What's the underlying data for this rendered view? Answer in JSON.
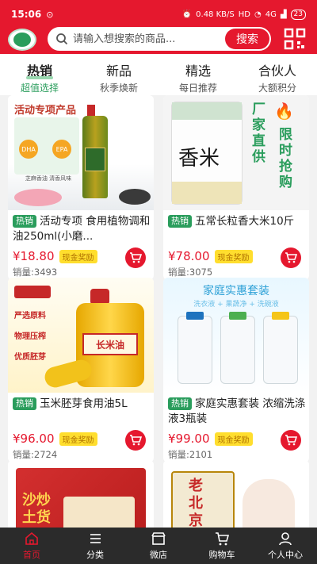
{
  "status_bar": {
    "time": "15:06",
    "net_speed": "0.48",
    "net_unit": "KB/S",
    "network": "HD",
    "signal": "4G",
    "battery": "23"
  },
  "search": {
    "placeholder": "请输入想搜索的商品...",
    "button_label": "搜索"
  },
  "tabs": [
    {
      "label": "热销",
      "sub": "超值选择"
    },
    {
      "label": "新品",
      "sub": "秋季焕新"
    },
    {
      "label": "精选",
      "sub": "每日推荐"
    },
    {
      "label": "合伙人",
      "sub": "大额积分"
    }
  ],
  "products": [
    {
      "tag": "热销",
      "title": "活动专项 食用植物调和油250ml(小磨...",
      "price": "¥18.80",
      "reward": "现金奖励",
      "sales": "销量:3493",
      "img_text": "活动专项产品",
      "img_sub1": "DHA",
      "img_sub2": "EPA",
      "img_foot": "芝麻香油 清香风味"
    },
    {
      "tag": "热销",
      "title": "五常长粒香大米10斤",
      "price": "¥78.00",
      "reward": "现金奖励",
      "sales": "销量:3075",
      "img_text": "厂家直供",
      "img_text2": "限时抢购",
      "img_bag": "香米"
    },
    {
      "tag": "热销",
      "title": "玉米胚芽食用油5L",
      "price": "¥96.00",
      "reward": "现金奖励",
      "sales": "销量:2724",
      "img_points": [
        "严选原料",
        "物理压榨",
        "优质胚芽"
      ],
      "img_label": "长米油"
    },
    {
      "tag": "热销",
      "title": "家庭实惠套装 浓缩洗涤液3瓶装",
      "price": "¥99.00",
      "reward": "现金奖励",
      "sales": "销量:2101",
      "img_text": "家庭实惠套装",
      "img_sub": "洗衣液 + 果蔬净 + 洗碗液"
    },
    {
      "img_text": "沙炒土货"
    },
    {
      "img_text": "老北京"
    }
  ],
  "bottom_nav": [
    {
      "label": "首页",
      "icon": "home-icon"
    },
    {
      "label": "分类",
      "icon": "list-icon"
    },
    {
      "label": "微店",
      "icon": "shop-icon"
    },
    {
      "label": "购物车",
      "icon": "cart-icon"
    },
    {
      "label": "个人中心",
      "icon": "user-icon"
    }
  ],
  "colors": {
    "brand_red": "#e5182e",
    "accent_green": "#2a9d5c",
    "reward_yellow": "#ffde2e"
  }
}
